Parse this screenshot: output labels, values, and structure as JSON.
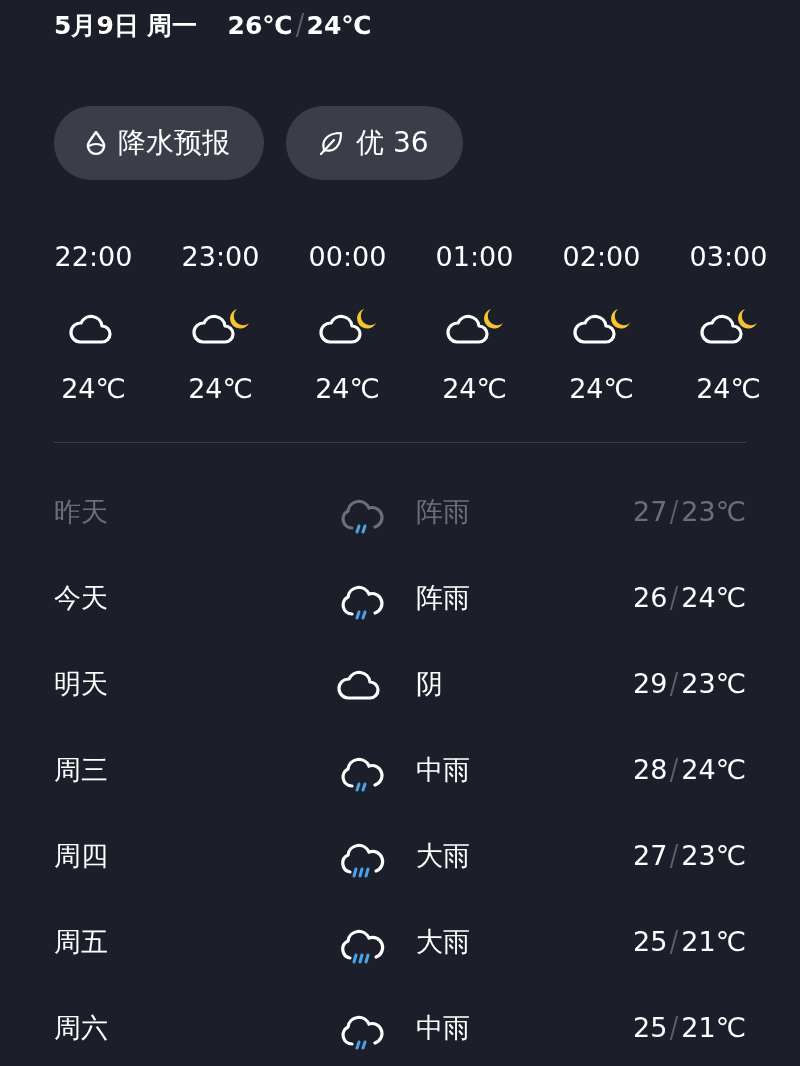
{
  "header": {
    "date": "5月9日 周一",
    "high": "26℃",
    "low": "24℃"
  },
  "chips": [
    {
      "kind": "precipitation",
      "label": "降水预报"
    },
    {
      "kind": "air-quality",
      "label": "优 36"
    }
  ],
  "hourly": [
    {
      "time": "22:00",
      "kind": "cloudy",
      "temp": "24℃"
    },
    {
      "time": "23:00",
      "kind": "cloudy-night",
      "temp": "24℃"
    },
    {
      "time": "00:00",
      "kind": "cloudy-night",
      "temp": "24℃"
    },
    {
      "time": "01:00",
      "kind": "cloudy-night",
      "temp": "24℃"
    },
    {
      "time": "02:00",
      "kind": "cloudy-night",
      "temp": "24℃"
    },
    {
      "time": "03:00",
      "kind": "cloudy-night",
      "temp": "24℃"
    }
  ],
  "daily": [
    {
      "day": "昨天",
      "kind": "light-rain",
      "condition": "阵雨",
      "high": "27",
      "low": "23℃",
      "past": true
    },
    {
      "day": "今天",
      "kind": "light-rain",
      "condition": "阵雨",
      "high": "26",
      "low": "24℃",
      "past": false
    },
    {
      "day": "明天",
      "kind": "cloudy",
      "condition": "阴",
      "high": "29",
      "low": "23℃",
      "past": false
    },
    {
      "day": "周三",
      "kind": "light-rain",
      "condition": "中雨",
      "high": "28",
      "low": "24℃",
      "past": false
    },
    {
      "day": "周四",
      "kind": "heavy-rain",
      "condition": "大雨",
      "high": "27",
      "low": "23℃",
      "past": false
    },
    {
      "day": "周五",
      "kind": "heavy-rain",
      "condition": "大雨",
      "high": "25",
      "low": "21℃",
      "past": false
    },
    {
      "day": "周六",
      "kind": "light-rain",
      "condition": "中雨",
      "high": "25",
      "low": "21℃",
      "past": false
    }
  ]
}
